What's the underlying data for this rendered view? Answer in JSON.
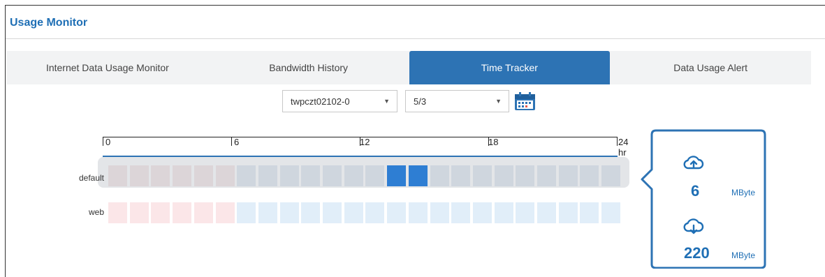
{
  "page": {
    "title": "Usage Monitor"
  },
  "tabs": [
    {
      "label": "Internet Data Usage Monitor",
      "active": false
    },
    {
      "label": "Bandwidth History",
      "active": false
    },
    {
      "label": "Time Tracker",
      "active": true
    },
    {
      "label": "Data Usage Alert",
      "active": false
    }
  ],
  "filters": {
    "device": {
      "value": "twpczt02102-0"
    },
    "date": {
      "value": "5/3"
    },
    "calendar_icon": "calendar-icon"
  },
  "timeline": {
    "scale_labels": [
      "0",
      "6",
      "12",
      "18",
      "24 hr"
    ],
    "rows": [
      {
        "label": "default",
        "highlighted": true,
        "active_hours": [
          13,
          14
        ]
      },
      {
        "label": "web",
        "highlighted": false,
        "active_hours": []
      }
    ],
    "colors": {
      "active": "#2e7ed3",
      "default_early": "#dcd5d8",
      "default_late": "#cfd6de",
      "web_early": "#fbe6e8",
      "web_late": "#e1eef9"
    }
  },
  "usage": {
    "upload_icon": "cloud-upload-icon",
    "upload_value": "6",
    "upload_unit": "MByte",
    "download_icon": "cloud-download-icon",
    "download_value": "220",
    "download_unit": "MByte"
  }
}
